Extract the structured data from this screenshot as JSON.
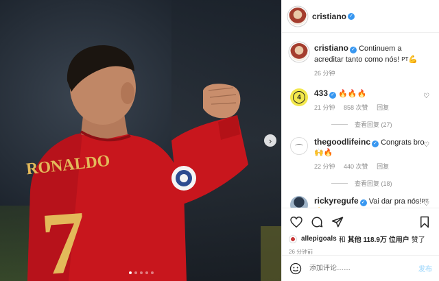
{
  "header": {
    "username": "cristiano"
  },
  "caption": {
    "username": "cristiano",
    "text": "Continuem a acreditar tanto como nós!",
    "flag": "PT",
    "time": "26 分钟"
  },
  "comments": [
    {
      "username": "433",
      "emojis": "🔥🔥🔥",
      "text": "",
      "time": "21 分钟",
      "likes": "858 次赞",
      "reply": "回复",
      "view_replies": "查看回复 (27)",
      "avatar_icon": "433-logo"
    },
    {
      "username": "thegoodlifeinc",
      "text": "Congrats bro",
      "emojis": "🙌🔥",
      "time": "22 分钟",
      "likes": "440 次赞",
      "reply": "回复",
      "view_replies": "查看回复 (18)",
      "avatar_icon": "goodlife-logo"
    },
    {
      "username": "rickyregufe",
      "text": "Vai dar pra nós!",
      "flag": "PT",
      "emojis": "💪",
      "avatar_icon": "ricky-avatar"
    }
  ],
  "likes": {
    "liker": "allepigoals",
    "connector": "和",
    "others": "其他 118.9万 位用户",
    "suffix": "赞了"
  },
  "post_time": "26 分钟前",
  "add_comment": {
    "placeholder": "添加评论……",
    "post_label": "发布"
  },
  "photo": {
    "jersey_name": "RONALDO",
    "jersey_number": "7"
  },
  "colors": {
    "verified": "#3897f0",
    "jersey_red": "#c8161d",
    "jersey_gold": "#e3b95a",
    "post_disabled": "#b2dffc"
  }
}
